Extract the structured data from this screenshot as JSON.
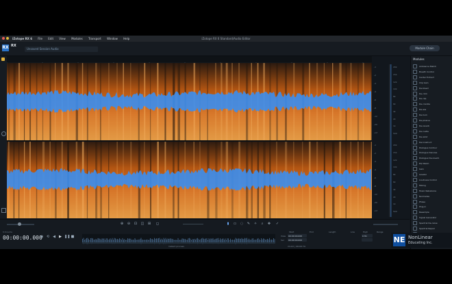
{
  "menubar": {
    "app": "iZotope RX 6",
    "items": [
      "File",
      "Edit",
      "View",
      "Modules",
      "Transport",
      "Window",
      "Help"
    ],
    "window_title": "iZotope RX 6 Standard/Audio Editor"
  },
  "header": {
    "logo": "RX",
    "product": "RX",
    "file_tab": "Unsaved Session Audio",
    "top_button": "Module Chain"
  },
  "panel": {
    "title": "Modules",
    "items": [
      "Ambience Match",
      "Breath Control",
      "Center Extract",
      "Clip Gain",
      "De-bleed",
      "De-click",
      "De-clip",
      "De-crackle",
      "De-ess",
      "De-hum",
      "De-plosive",
      "De-reverb",
      "De-rustle",
      "De-wind",
      "Deconstruct",
      "Dialogue Contour",
      "Dialogue Denoise",
      "Dialogue De-reverb",
      "EQ Match",
      "Gain",
      "Leveler",
      "Loudness Control",
      "Mixing",
      "Music Rebalance",
      "Normalize",
      "Phase",
      "Plug-in",
      "Resample",
      "Signal Generator",
      "Spectral De-noise",
      "Spectral Repair",
      "Time & Pitch"
    ]
  },
  "scale": {
    "db_labels": [
      "-1",
      "-2",
      "-3",
      "-4",
      "-6",
      "-8",
      "-12",
      "-20",
      "-inf"
    ],
    "hz_labels": [
      "20k",
      "15k",
      "12k",
      "10k",
      "8k",
      "6k",
      "4k",
      "2k",
      "1k",
      "500"
    ]
  },
  "transport": {
    "time": "00:00:00.000",
    "time_format": "h:m:s.ms",
    "sel_start_label": "Start",
    "sel_end_label": "End",
    "sel_length_label": "Length",
    "sel_low_label": "Low",
    "sel_high_label": "High",
    "sel_range_label": "Range",
    "view_label": "View",
    "sel_label": "Sel",
    "sel_start": "00:00:00.000",
    "sel_end": "00:00:00.000",
    "hz_value": "0 Hz",
    "bits_label": "24-bit | 44100 Hz",
    "instant_process": "Instant process"
  },
  "watermark": {
    "logo": "NE",
    "line1": "NonLinear",
    "line2": "Educating Inc."
  },
  "colors": {
    "waveform": "#3b8ef0",
    "spectro_high": "#e39a45",
    "spectro_low": "#2b1a10",
    "accent": "#2a73c8"
  }
}
